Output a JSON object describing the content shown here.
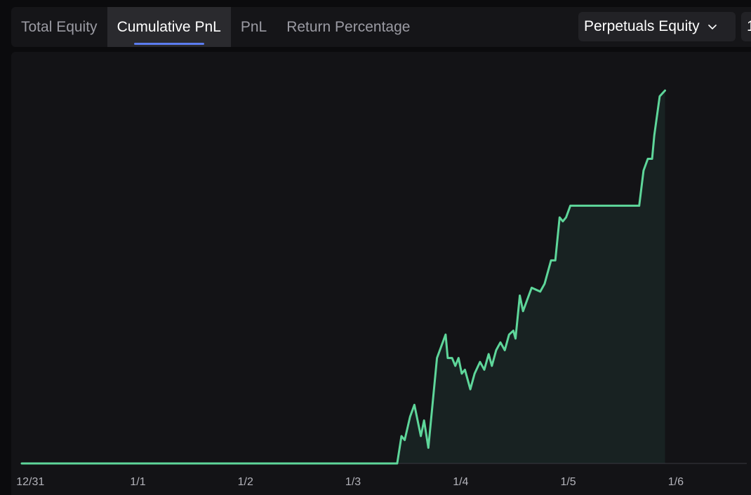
{
  "tabs": [
    {
      "label": "Total Equity",
      "active": false
    },
    {
      "label": "Cumulative PnL",
      "active": true
    },
    {
      "label": "PnL",
      "active": false
    },
    {
      "label": "Return Percentage",
      "active": false
    }
  ],
  "dropdown": {
    "label": "Perpetuals Equity",
    "icon": "chevron-down-icon"
  },
  "dropdown2": {
    "label": "1"
  },
  "colors": {
    "line": "#5ed69a",
    "fill": "#1a2624",
    "active_tab_underline": "#5b7cf0"
  },
  "chart_data": {
    "type": "area",
    "title": "",
    "xlabel": "",
    "ylabel": "",
    "x_ticks": [
      "12/31",
      "1/1",
      "1/2",
      "1/3",
      "1/4",
      "1/5",
      "1/6"
    ],
    "x_range": [
      -0.08,
      6.66
    ],
    "y_range": [
      0,
      100
    ],
    "y_ticks_shown": false,
    "grid": false,
    "legend": "none",
    "series": [
      {
        "points": [
          [
            -0.08,
            0
          ],
          [
            3.41,
            0
          ],
          [
            3.45,
            7
          ],
          [
            3.48,
            6
          ],
          [
            3.53,
            12
          ],
          [
            3.57,
            15
          ],
          [
            3.63,
            7
          ],
          [
            3.66,
            11
          ],
          [
            3.7,
            4
          ],
          [
            3.78,
            27
          ],
          [
            3.86,
            33
          ],
          [
            3.88,
            27
          ],
          [
            3.92,
            27
          ],
          [
            3.95,
            25
          ],
          [
            3.98,
            27
          ],
          [
            4.01,
            23
          ],
          [
            4.04,
            24
          ],
          [
            4.09,
            19
          ],
          [
            4.13,
            23
          ],
          [
            4.18,
            26
          ],
          [
            4.22,
            24
          ],
          [
            4.26,
            28
          ],
          [
            4.29,
            25
          ],
          [
            4.33,
            29
          ],
          [
            4.37,
            31
          ],
          [
            4.41,
            29
          ],
          [
            4.45,
            33
          ],
          [
            4.49,
            34
          ],
          [
            4.51,
            32
          ],
          [
            4.55,
            43
          ],
          [
            4.58,
            39
          ],
          [
            4.62,
            42
          ],
          [
            4.66,
            45
          ],
          [
            4.74,
            44
          ],
          [
            4.78,
            46
          ],
          [
            4.84,
            52
          ],
          [
            4.88,
            52
          ],
          [
            4.92,
            63
          ],
          [
            4.95,
            62
          ],
          [
            4.98,
            63
          ],
          [
            5.02,
            66
          ],
          [
            5.15,
            66
          ],
          [
            5.4,
            66
          ],
          [
            5.58,
            66
          ],
          [
            5.66,
            66
          ],
          [
            5.7,
            75
          ],
          [
            5.74,
            78
          ],
          [
            5.78,
            78
          ],
          [
            5.8,
            84
          ],
          [
            5.85,
            94
          ],
          [
            5.9,
            95.5
          ]
        ]
      }
    ]
  }
}
